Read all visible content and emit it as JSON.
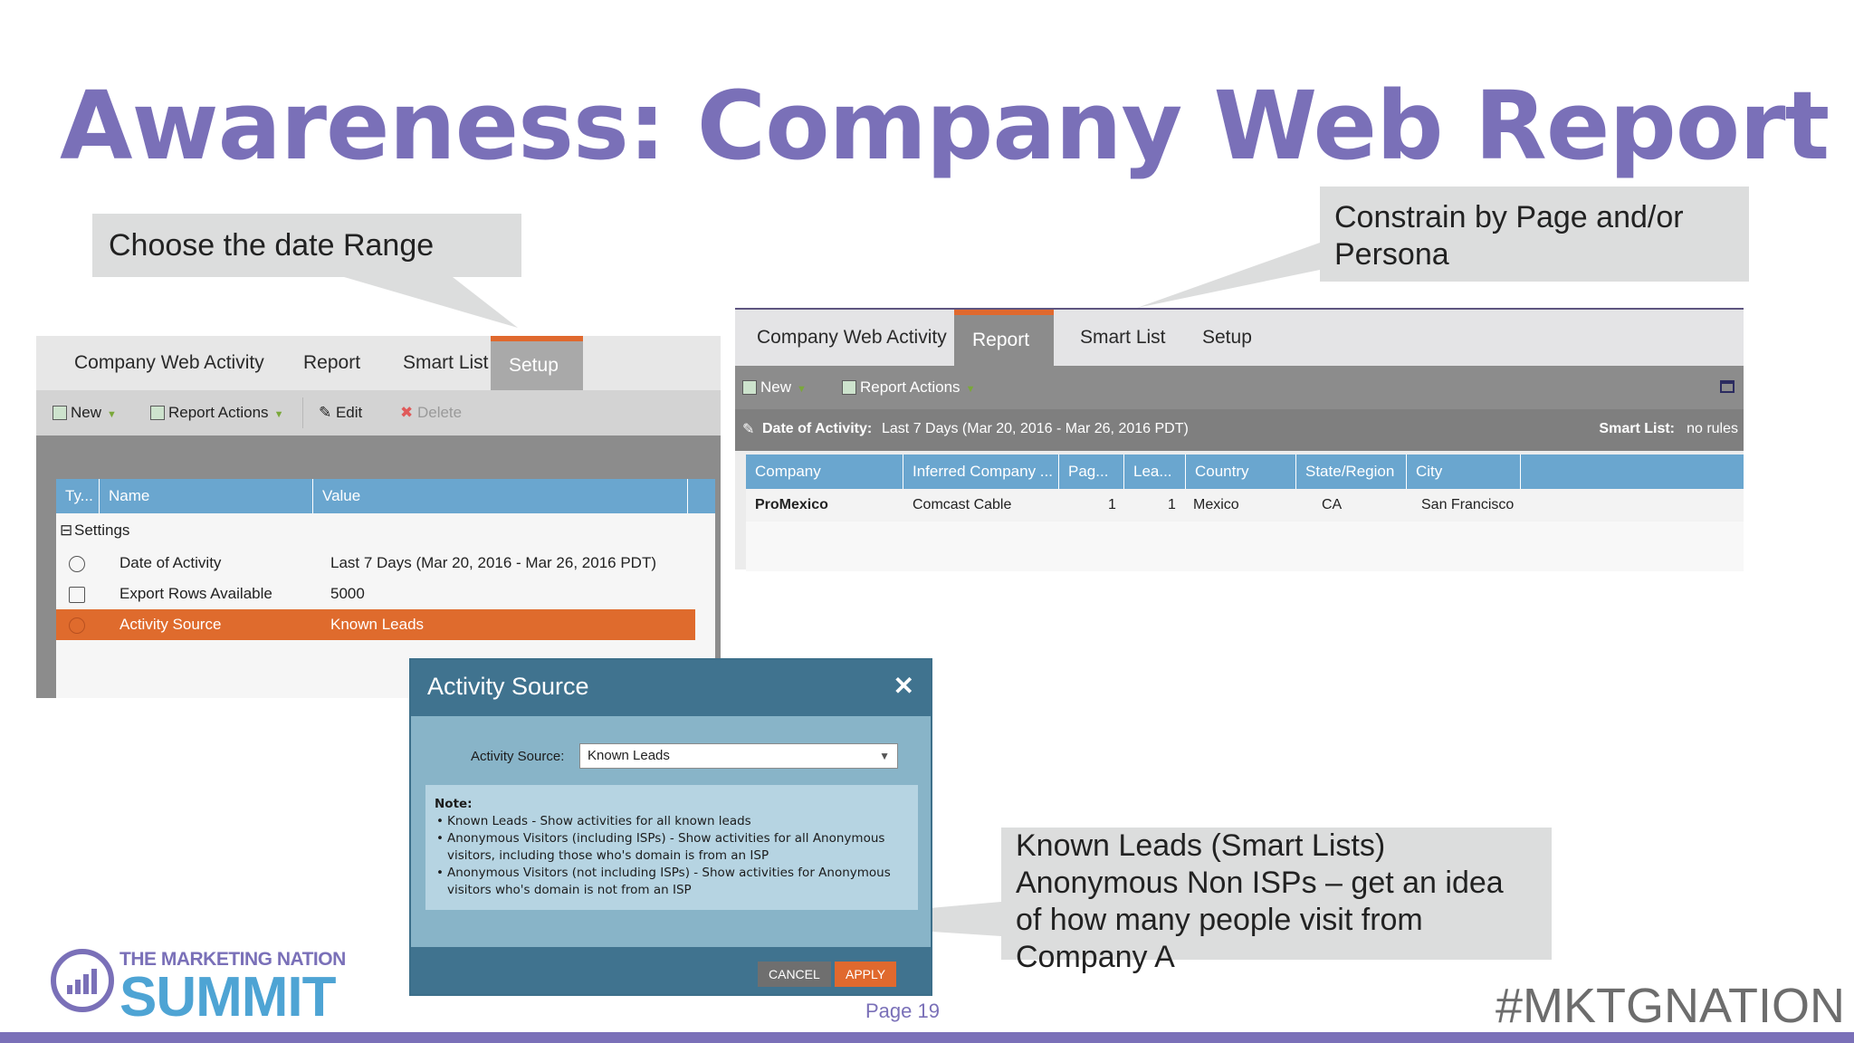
{
  "slide": {
    "title": "Awareness: Company Web Report",
    "callout_date": "Choose the date Range",
    "callout_constrain": "Constrain by Page and/or Persona",
    "callout_known": "Known Leads (Smart Lists) Anonymous Non ISPs – get an idea of how many people visit from Company A",
    "page": "Page 19",
    "hashtag": "#MKTGNATION",
    "logo_top": "THE MARKETING NATION",
    "logo_bottom": "SUMMIT"
  },
  "left_panel": {
    "tabs": [
      "Company Web Activity",
      "Report",
      "Smart List",
      "Setup"
    ],
    "active_tab": "Setup",
    "toolbar": {
      "new": "New",
      "report_actions": "Report Actions",
      "edit": "Edit",
      "delete": "Delete"
    },
    "grid_headers": [
      "Ty...",
      "Name",
      "Value"
    ],
    "group": "Settings",
    "rows": [
      {
        "name": "Date of Activity",
        "value": "Last 7 Days (Mar 20, 2016 - Mar 26, 2016 PDT)",
        "icon": "clock-icon"
      },
      {
        "name": "Export Rows Available",
        "value": "5000",
        "icon": "export-icon"
      },
      {
        "name": "Activity Source",
        "value": "Known Leads",
        "icon": "gear-icon",
        "selected": true
      }
    ]
  },
  "right_panel": {
    "tabs": [
      "Company Web Activity",
      "Report",
      "Smart List",
      "Setup"
    ],
    "active_tab": "Report",
    "toolbar": {
      "new": "New",
      "report_actions": "Report Actions"
    },
    "filter_label": "Date of Activity:",
    "filter_value": "Last 7 Days (Mar 20, 2016 - Mar 26, 2016 PDT)",
    "smart_list_label": "Smart List:",
    "smart_list_value": "no rules",
    "columns": [
      "Company",
      "Inferred Company ...",
      "Pag...",
      "Lea...",
      "Country",
      "State/Region",
      "City"
    ],
    "row": {
      "company": "ProMexico",
      "inferred": "Comcast Cable",
      "pages": "1",
      "leads": "1",
      "country": "Mexico",
      "state": "CA",
      "city": "San Francisco"
    }
  },
  "modal": {
    "title": "Activity Source",
    "field_label": "Activity Source:",
    "selected_option": "Known Leads",
    "note_title": "Note:",
    "notes": [
      "Known Leads - Show activities for all known leads",
      "Anonymous Visitors (including ISPs) - Show activities for all Anonymous visitors, including those who's domain is from an ISP",
      "Anonymous Visitors (not including ISPs) - Show activities for Anonymous visitors who's domain is not from an ISP"
    ],
    "cancel": "CANCEL",
    "apply": "APPLY"
  }
}
